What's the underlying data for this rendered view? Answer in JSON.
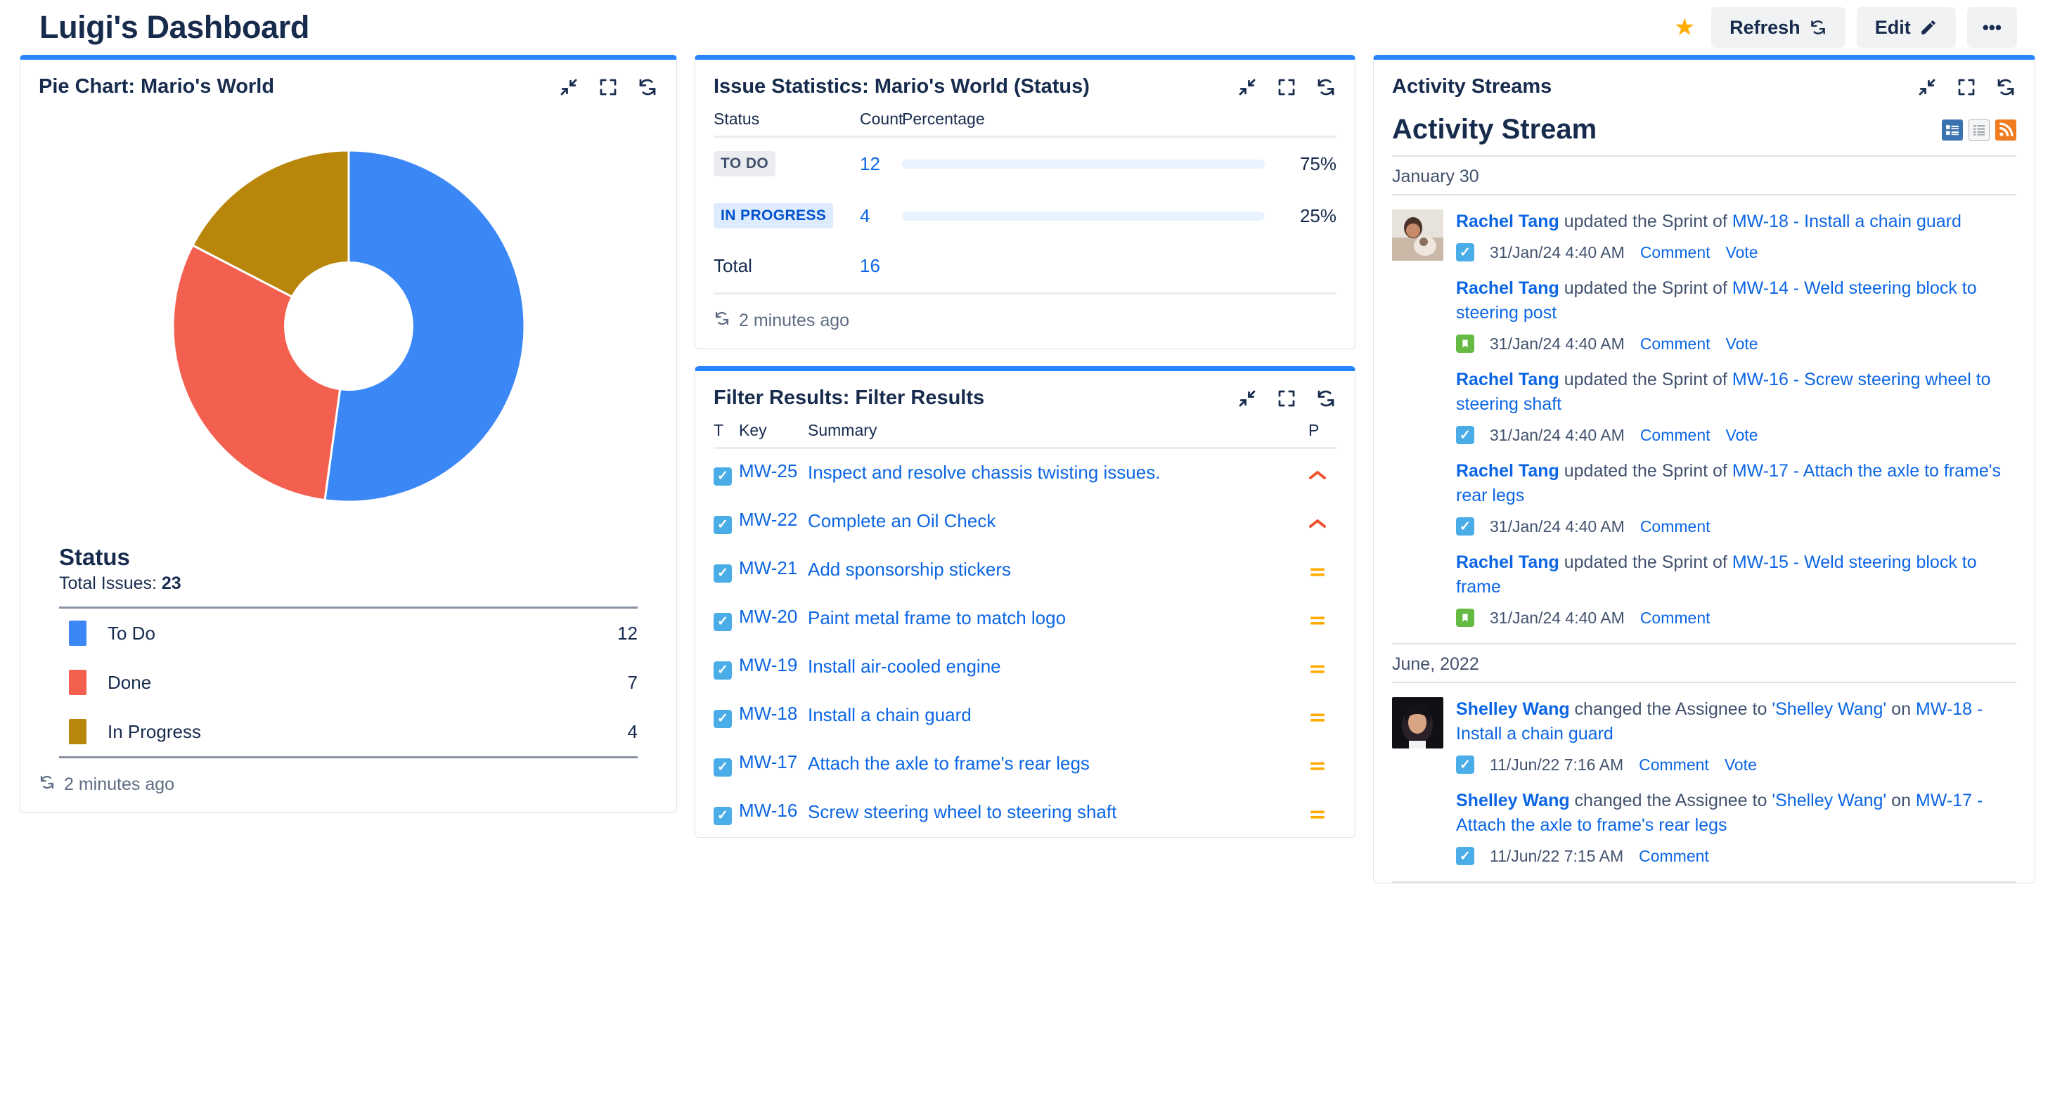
{
  "header": {
    "title": "Luigi's Dashboard",
    "star_icon": "star-icon",
    "refresh_label": "Refresh",
    "edit_label": "Edit",
    "more_label": "•••"
  },
  "pie_gadget": {
    "title": "Pie Chart: Mario's World",
    "status_heading": "Status",
    "total_label": "Total Issues:",
    "total_value": "23",
    "footer": "2 minutes ago",
    "legend": [
      {
        "label": "To Do",
        "value": "12",
        "color": "#3B87F5"
      },
      {
        "label": "Done",
        "value": "7",
        "color": "#F4604F"
      },
      {
        "label": "In Progress",
        "value": "4",
        "color": "#B8860B"
      }
    ]
  },
  "chart_data": {
    "type": "pie",
    "title": "Pie Chart: Mario's World",
    "subtitle": "Status",
    "categories": [
      "To Do",
      "Done",
      "In Progress"
    ],
    "values": [
      12,
      7,
      4
    ],
    "colors": [
      "#3B87F5",
      "#F4604F",
      "#B8860B"
    ],
    "total": 23,
    "percentages": [
      52.2,
      30.4,
      17.4
    ],
    "donut": true,
    "legend_position": "bottom",
    "start_angle_deg": 0
  },
  "stats_gadget": {
    "title": "Issue Statistics: Mario's World (Status)",
    "columns": {
      "status": "Status",
      "count": "Count",
      "percentage": "Percentage"
    },
    "rows": [
      {
        "status": "TO DO",
        "badge": "todo",
        "count": "12",
        "percent": "75%",
        "pct_value": 75
      },
      {
        "status": "IN PROGRESS",
        "badge": "prog",
        "count": "4",
        "percent": "25%",
        "pct_value": 25
      }
    ],
    "total_label": "Total",
    "total_count": "16",
    "footer": "2 minutes ago"
  },
  "filter_gadget": {
    "title": "Filter Results: Filter Results",
    "columns": {
      "t": "T",
      "key": "Key",
      "summary": "Summary",
      "p": "P"
    },
    "rows": [
      {
        "type": "task",
        "key": "MW-25",
        "summary": "Inspect and resolve chassis twisting issues.",
        "priority": "high"
      },
      {
        "type": "task",
        "key": "MW-22",
        "summary": "Complete an Oil Check",
        "priority": "high"
      },
      {
        "type": "task",
        "key": "MW-21",
        "summary": "Add sponsorship stickers",
        "priority": "medium"
      },
      {
        "type": "task",
        "key": "MW-20",
        "summary": "Paint metal frame to match logo",
        "priority": "medium"
      },
      {
        "type": "task",
        "key": "MW-19",
        "summary": "Install air-cooled engine",
        "priority": "medium"
      },
      {
        "type": "task",
        "key": "MW-18",
        "summary": "Install a chain guard",
        "priority": "medium"
      },
      {
        "type": "task",
        "key": "MW-17",
        "summary": "Attach the axle to frame's rear legs",
        "priority": "medium"
      },
      {
        "type": "task",
        "key": "MW-16",
        "summary": "Screw steering wheel to steering shaft",
        "priority": "medium"
      }
    ]
  },
  "activity_gadget": {
    "title": "Activity Streams",
    "stream_heading": "Activity Stream",
    "view_icons": [
      "list-view-icon",
      "detail-view-icon",
      "rss-feed-icon"
    ],
    "groups": [
      {
        "date": "January 30",
        "items": [
          {
            "avatar": true,
            "user": "Rachel Tang",
            "action": " updated the Sprint of ",
            "target": "MW-18 - Install a chain guard",
            "issue_type": "task",
            "timestamp": "31/Jan/24 4:40 AM",
            "actions": [
              "Comment",
              "Vote"
            ]
          },
          {
            "avatar": false,
            "user": "Rachel Tang",
            "action": " updated the Sprint of ",
            "target": "MW-14 - Weld steering block to steering post",
            "issue_type": "story",
            "timestamp": "31/Jan/24 4:40 AM",
            "actions": [
              "Comment",
              "Vote"
            ]
          },
          {
            "avatar": false,
            "user": "Rachel Tang",
            "action": " updated the Sprint of ",
            "target": "MW-16 - Screw steering wheel to steering shaft",
            "issue_type": "task",
            "timestamp": "31/Jan/24 4:40 AM",
            "actions": [
              "Comment",
              "Vote"
            ]
          },
          {
            "avatar": false,
            "user": "Rachel Tang",
            "action": " updated the Sprint of ",
            "target": "MW-17 - Attach the axle to frame's rear legs",
            "issue_type": "task",
            "timestamp": "31/Jan/24 4:40 AM",
            "actions": [
              "Comment"
            ]
          },
          {
            "avatar": false,
            "user": "Rachel Tang",
            "action": " updated the Sprint of ",
            "target": "MW-15 - Weld steering block to frame",
            "issue_type": "story",
            "timestamp": "31/Jan/24 4:40 AM",
            "actions": [
              "Comment"
            ]
          }
        ]
      },
      {
        "date": "June, 2022",
        "items": [
          {
            "avatar": true,
            "user": "Shelley Wang",
            "action": " changed the Assignee to ",
            "quoted": "'Shelley Wang'",
            "action2": " on ",
            "target": "MW-18 - Install a chain guard",
            "issue_type": "task",
            "timestamp": "11/Jun/22 7:16 AM",
            "actions": [
              "Comment",
              "Vote"
            ]
          },
          {
            "avatar": false,
            "user": "Shelley Wang",
            "action": " changed the Assignee to ",
            "quoted": "'Shelley Wang'",
            "action2": " on ",
            "target": "MW-17 - Attach the axle to frame's rear legs",
            "issue_type": "task",
            "timestamp": "11/Jun/22 7:15 AM",
            "actions": [
              "Comment"
            ]
          }
        ]
      }
    ]
  }
}
